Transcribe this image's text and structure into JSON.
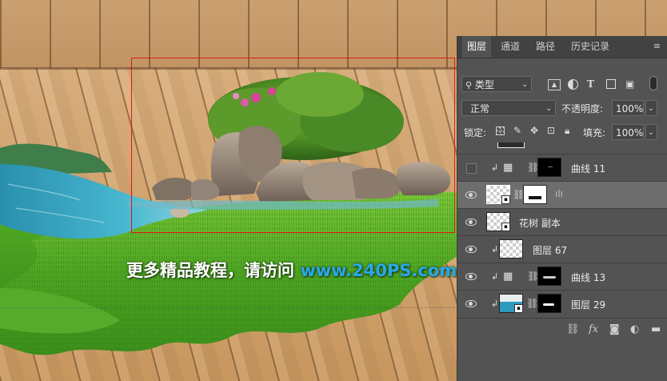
{
  "canvas": {
    "watermark_main": "更多精品教程，请访问 ",
    "watermark_site": "www.240PS.com"
  },
  "panel": {
    "tabs": [
      "图层",
      "通道",
      "路径",
      "历史记录"
    ],
    "active_tab": "图层",
    "filter_kind": "类型",
    "blend_mode": "正常",
    "opacity_label": "不透明度:",
    "opacity_value": "100%",
    "lock_label": "锁定:",
    "fill_label": "填充:",
    "fill_value": "100%",
    "layers": [
      {
        "name": "曲线 11",
        "visible": false,
        "clipped": true,
        "type": "adjustment"
      },
      {
        "name": "",
        "visible": true,
        "clipped": false,
        "type": "adjustment",
        "selected": true
      },
      {
        "name": "花树 副本",
        "visible": true,
        "clipped": false,
        "type": "smart"
      },
      {
        "name": "图层 67",
        "visible": true,
        "clipped": true,
        "type": "pixel"
      },
      {
        "name": "曲线 13",
        "visible": true,
        "clipped": true,
        "type": "adjustment"
      },
      {
        "name": "图层 29",
        "visible": true,
        "clipped": true,
        "type": "smart"
      }
    ],
    "footer_icons": [
      "link-icon",
      "fx-icon",
      "mask-icon",
      "adjustment-icon",
      "folder-icon"
    ]
  }
}
